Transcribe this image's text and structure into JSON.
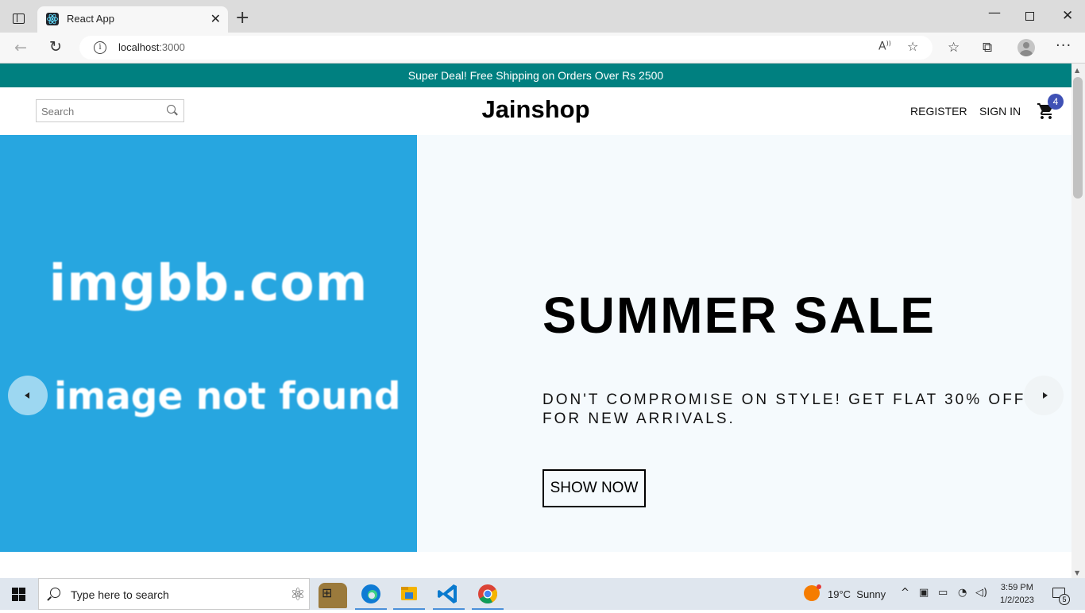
{
  "browser": {
    "tab_title": "React App",
    "new_tab_symbol": "+",
    "url_host": "localhost",
    "url_port": ":3000"
  },
  "announcement": {
    "text": "Super Deal! Free Shipping on Orders Over Rs 2500"
  },
  "navbar": {
    "search_placeholder": "Search",
    "logo": "Jainshop",
    "register_label": "REGISTER",
    "signin_label": "SIGN IN",
    "cart_count": "4"
  },
  "slider": {
    "image_text_line1": "imgbb.com",
    "image_text_line2": "image not found",
    "title": "SUMMER SALE",
    "description": "DON'T COMPROMISE ON STYLE! GET FLAT 30% OFF FOR NEW ARRIVALS.",
    "button_label": "SHOW NOW"
  },
  "taskbar": {
    "search_placeholder": "Type here to search",
    "weather_temp": "19°C",
    "weather_desc": "Sunny",
    "time": "3:59 PM",
    "date": "1/2/2023",
    "notification_count": "5"
  },
  "colors": {
    "announcement_bg": "#008080",
    "image_bg": "#27a6e0",
    "badge": "#3f51b5"
  }
}
